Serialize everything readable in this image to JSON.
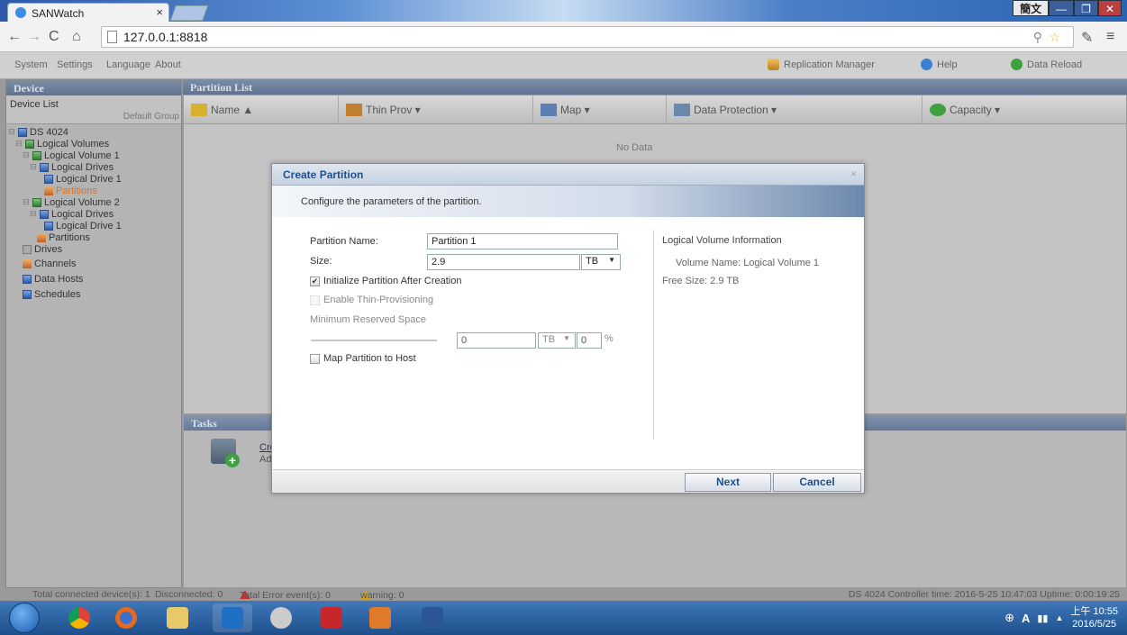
{
  "browser": {
    "tab_title": "SANWatch",
    "tab_close": "×",
    "url": "127.0.0.1:8818",
    "ime_label": "簡文",
    "min": "—",
    "max": "❐",
    "close": "✕"
  },
  "menubar": {
    "items": [
      "System",
      "Settings",
      "Language",
      "About"
    ],
    "replication": "Replication Manager",
    "help": "Help",
    "reload": "Data Reload"
  },
  "left_panel": {
    "header": "Device",
    "device_list": "Device List",
    "default_group": "Default Group",
    "tree": [
      "DS 4024",
      "Logical Volumes",
      "Logical Volume 1",
      "Logical Drives",
      "Logical Drive 1",
      "Partitions",
      "Logical Volume 2",
      "Logical Drives",
      "Logical Drive 1",
      "Partitions",
      "Drives",
      "Channels",
      "Data Hosts",
      "Schedules"
    ]
  },
  "partition_list": {
    "header": "Partition List",
    "columns": [
      "Name ▲",
      "Thin Prov ▾",
      "Map ▾",
      "Data Protection ▾",
      "Capacity ▾"
    ],
    "empty_text": "No Data"
  },
  "tasks": {
    "header": "Tasks",
    "link": "Cre",
    "desc": "Ad"
  },
  "dialog": {
    "title": "Create Partition",
    "close": "×",
    "description": "Configure the parameters of the partition.",
    "partition_name_label": "Partition Name:",
    "partition_name_value": "Partition 1",
    "size_label": "Size:",
    "size_value": "2.9",
    "size_unit": "TB",
    "init_label": "Initialize Partition After Creation",
    "init_checked": true,
    "thin_label": "Enable Thin-Provisioning",
    "min_reserved_label": "Minimum Reserved Space",
    "reserved_value": "0",
    "reserved_unit": "TB",
    "reserved_pct": "0",
    "pct_sign": "%",
    "map_label": "Map Partition to Host",
    "info_title": "Logical Volume Information",
    "volume_name": "Volume Name: Logical Volume 1",
    "free_size": "Free Size: 2.9 TB",
    "next": "Next",
    "cancel": "Cancel"
  },
  "statusbar": {
    "connected": "Total connected device(s): 1",
    "disconnected": "Disconnected: 0",
    "errors": "Total Error event(s): 0",
    "warning": "warning: 0",
    "right": "DS 4024  Controller time: 2016-5-25 10:47:03 Uptime: 0:00:19:25"
  },
  "taskbar": {
    "time": "上午 10:55",
    "date": "2016/5/25",
    "tray": "A"
  },
  "colors": {
    "accent": "#1f4f8f",
    "panel_header": "#5f7290"
  }
}
